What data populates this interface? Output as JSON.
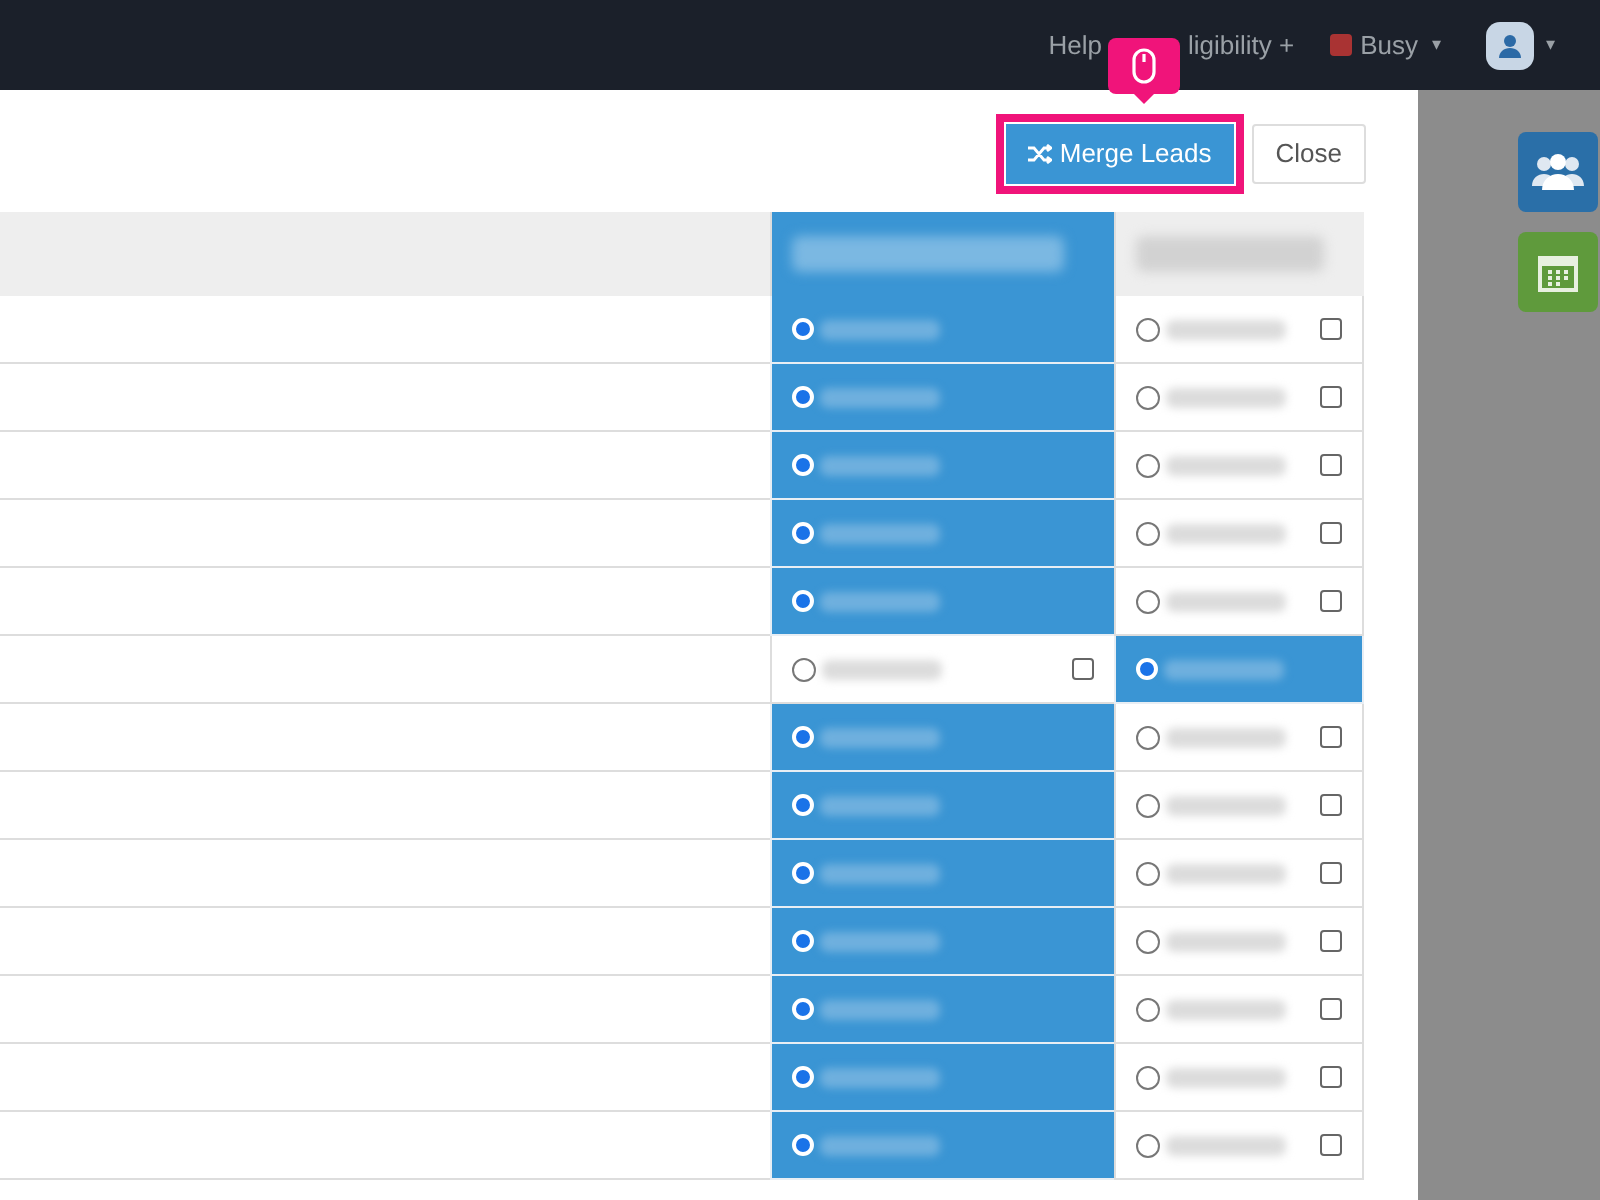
{
  "navbar": {
    "links": [
      {
        "label": "Help"
      },
      {
        "label": "ligibility +"
      }
    ],
    "status": {
      "label": "Busy",
      "caret": "▾"
    },
    "user_menu": {
      "caret": "▾"
    }
  },
  "modal": {
    "buttons": [
      {
        "label": "Merge Leads",
        "kind": "primary",
        "highlighted": true
      },
      {
        "label": "Close",
        "kind": "default",
        "highlighted": false
      }
    ]
  },
  "table": {
    "header_selected": [
      true,
      false
    ],
    "rows": [
      {
        "cells": [
          {
            "selected": true
          },
          {
            "selected": false
          }
        ]
      },
      {
        "cells": [
          {
            "selected": true
          },
          {
            "selected": false
          }
        ]
      },
      {
        "cells": [
          {
            "selected": true
          },
          {
            "selected": false
          }
        ]
      },
      {
        "cells": [
          {
            "selected": true
          },
          {
            "selected": false
          }
        ]
      },
      {
        "cells": [
          {
            "selected": true
          },
          {
            "selected": false
          }
        ]
      },
      {
        "cells": [
          {
            "selected": false
          },
          {
            "selected": true
          }
        ]
      },
      {
        "cells": [
          {
            "selected": true
          },
          {
            "selected": false
          }
        ]
      },
      {
        "cells": [
          {
            "selected": true
          },
          {
            "selected": false
          }
        ]
      },
      {
        "cells": [
          {
            "selected": true
          },
          {
            "selected": false
          }
        ]
      },
      {
        "cells": [
          {
            "selected": true
          },
          {
            "selected": false
          }
        ]
      },
      {
        "cells": [
          {
            "selected": true
          },
          {
            "selected": false
          }
        ]
      },
      {
        "cells": [
          {
            "selected": true
          },
          {
            "selected": false
          }
        ]
      },
      {
        "cells": [
          {
            "selected": true
          },
          {
            "selected": false
          }
        ]
      }
    ]
  }
}
